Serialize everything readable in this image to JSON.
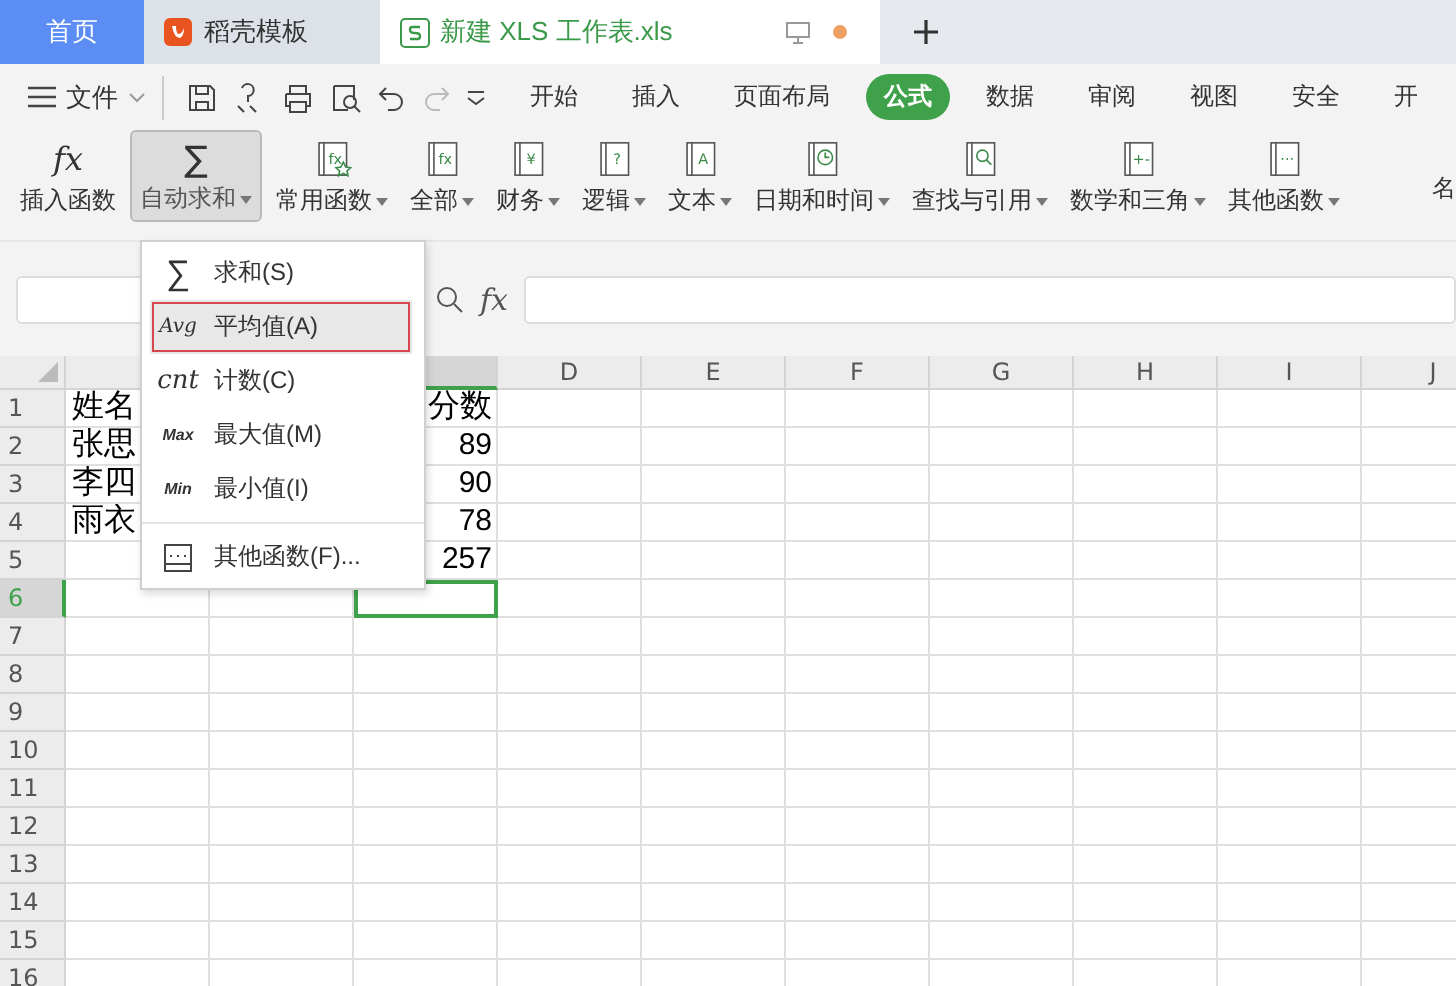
{
  "tabs": [
    {
      "label": "首页",
      "kind": "home",
      "selected": false
    },
    {
      "label": "稻壳模板",
      "kind": "docer",
      "selected": false
    },
    {
      "label": "新建 XLS 工作表.xls",
      "kind": "sheet",
      "selected": true
    }
  ],
  "menubar": {
    "file": "文件",
    "tabs": [
      {
        "label": "开始",
        "selected": false
      },
      {
        "label": "插入",
        "selected": false
      },
      {
        "label": "页面布局",
        "selected": false
      },
      {
        "label": "公式",
        "selected": true
      },
      {
        "label": "数据",
        "selected": false
      },
      {
        "label": "审阅",
        "selected": false
      },
      {
        "label": "视图",
        "selected": false
      },
      {
        "label": "安全",
        "selected": false
      },
      {
        "label": "开",
        "selected": false
      }
    ]
  },
  "ribbon": [
    {
      "label": "插入函数",
      "kind": "fx",
      "glyph": "fx",
      "selected": false,
      "dropdown": false
    },
    {
      "label": "自动求和",
      "kind": "sum",
      "glyph": "∑",
      "selected": true,
      "dropdown": true
    },
    {
      "label": "常用函数",
      "kind": "book-star",
      "glyph": "fx",
      "selected": false,
      "dropdown": true
    },
    {
      "label": "全部",
      "kind": "book",
      "glyph": "fx",
      "selected": false,
      "dropdown": true
    },
    {
      "label": "财务",
      "kind": "book",
      "glyph": "¥",
      "selected": false,
      "dropdown": true
    },
    {
      "label": "逻辑",
      "kind": "book",
      "glyph": "?",
      "selected": false,
      "dropdown": true
    },
    {
      "label": "文本",
      "kind": "book",
      "glyph": "A",
      "selected": false,
      "dropdown": true
    },
    {
      "label": "日期和时间",
      "kind": "book-clock",
      "selected": false,
      "dropdown": true
    },
    {
      "label": "查找与引用",
      "kind": "book-search",
      "selected": false,
      "dropdown": true
    },
    {
      "label": "数学和三角",
      "kind": "book",
      "glyph": "+-",
      "selected": false,
      "dropdown": true
    },
    {
      "label": "其他函数",
      "kind": "book",
      "glyph": "···",
      "selected": false,
      "dropdown": true
    },
    {
      "label": "名",
      "kind": "cut"
    }
  ],
  "formula_bar": {
    "fx": "fx"
  },
  "columns": [
    {
      "selected": false,
      "right_aligned": false
    },
    {},
    {
      "selected": true,
      "right_aligned": true
    },
    {
      "label": "D",
      "selected": false
    },
    {
      "label": "E",
      "selected": false
    },
    {
      "label": "F",
      "selected": false
    },
    {
      "label": "G",
      "selected": false
    },
    {
      "label": "H",
      "selected": false
    },
    {
      "label": "I",
      "selected": false
    },
    {
      "label": "J",
      "selected": false
    }
  ],
  "rows": [
    {
      "label": "1",
      "selected": false,
      "cells": [
        "姓名",
        "",
        "分数"
      ]
    },
    {
      "label": "2",
      "selected": false,
      "cells": [
        "张思",
        "",
        "89"
      ]
    },
    {
      "label": "3",
      "selected": false,
      "cells": [
        "李四",
        "",
        "90"
      ]
    },
    {
      "label": "4",
      "selected": false,
      "cells": [
        "雨衣",
        "",
        "78"
      ]
    },
    {
      "label": "5",
      "selected": false,
      "cells": [
        "",
        "",
        "257"
      ]
    },
    {
      "label": "6",
      "selected": true,
      "cells": [
        "",
        "",
        ""
      ]
    },
    {
      "label": "7",
      "selected": false,
      "cells": []
    },
    {
      "label": "8",
      "selected": false,
      "cells": []
    },
    {
      "label": "9",
      "selected": false,
      "cells": []
    },
    {
      "label": "10",
      "selected": false,
      "cells": []
    },
    {
      "label": "11",
      "selected": false,
      "cells": []
    },
    {
      "label": "12",
      "selected": false,
      "cells": []
    },
    {
      "label": "13",
      "selected": false,
      "cells": []
    },
    {
      "label": "14",
      "selected": false,
      "cells": []
    },
    {
      "label": "15",
      "selected": false,
      "cells": []
    },
    {
      "label": "16",
      "selected": false,
      "cells": []
    }
  ],
  "dropdown_menu": [
    {
      "label": "求和(S)",
      "glyph": "∑",
      "kind": "sum",
      "highlighted": false,
      "annotated": false
    },
    {
      "label": "平均值(A)",
      "glyph": "Avg",
      "kind": "small",
      "highlighted": true,
      "annotated": true
    },
    {
      "label": "计数(C)",
      "glyph": "cnt",
      "kind": "italic",
      "highlighted": false,
      "annotated": false
    },
    {
      "label": "最大值(M)",
      "glyph": "Max",
      "kind": "tiny",
      "highlighted": false,
      "annotated": false
    },
    {
      "label": "最小值(I)",
      "glyph": "Min",
      "kind": "tiny",
      "highlighted": false,
      "annotated": false
    },
    {
      "label": "其他函数(F)...",
      "kind": "more",
      "highlighted": false,
      "annotated": false
    }
  ]
}
